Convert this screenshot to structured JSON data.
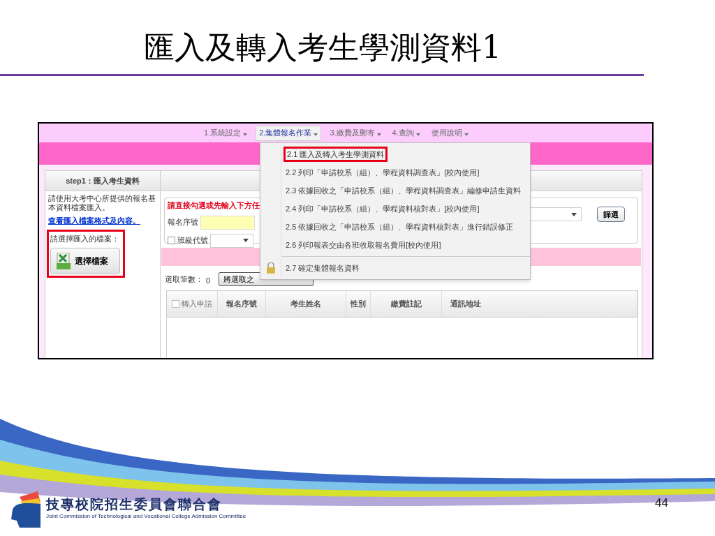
{
  "slide_title": "匯入及轉入考生學測資料1",
  "nav_menus": [
    {
      "label": "1.系統設定",
      "selected": false
    },
    {
      "label": "2.集體報名作業",
      "selected": true
    },
    {
      "label": "3.繳費及郵寄",
      "selected": false
    },
    {
      "label": "4.查詢",
      "selected": false
    },
    {
      "label": "使用說明",
      "selected": false
    }
  ],
  "dropdown_items": [
    {
      "label": "2.1 匯入及轉入考生學測資料",
      "kind": "item",
      "selected": true
    },
    {
      "label": "2.2 列印「申請校系（組）、學程資料調查表」[校內使用]",
      "kind": "item",
      "selected": false
    },
    {
      "label": "2.3 依據回收之「申請校系（組）、學程資料調查表」編修申請生資料",
      "kind": "item",
      "selected": false
    },
    {
      "label": "2.4 列印「申請校系（組）、學程資料核對表」[校內使用]",
      "kind": "item",
      "selected": false
    },
    {
      "label": "2.5 依據回收之「申請校系（組）、學程資料核對表」進行錯誤修正",
      "kind": "item",
      "selected": false
    },
    {
      "label": "2.6 列印報表交由各班收取報名費用[校內使用]",
      "kind": "item",
      "selected": false
    },
    {
      "label": "2.7 確定集體報名資料",
      "kind": "locked",
      "selected": false
    }
  ],
  "left_panel": {
    "step_title": "step1：匯入考生資料",
    "instructions": "請使用大考中心所提供的報名基本資料檔案匯入。",
    "format_link": "查看匯入檔案格式及內容。",
    "choose_label": "請選擇匯入的檔案：",
    "choose_button": "選擇檔案",
    "highlighted": true
  },
  "filter": {
    "hint": "請直接勾選或先輸入下方任",
    "serial_label": "報名序號",
    "class_checkbox": {
      "label": "班級代號",
      "checked": false
    },
    "filter_button": "篩選"
  },
  "selection": {
    "count_label": "選取筆數：",
    "count": "0",
    "transfer_button": "將選取之"
  },
  "table": {
    "select_all": {
      "label": "轉入申請",
      "checked": false
    },
    "columns": [
      "報名序號",
      "考生姓名",
      "性別",
      "繳費註記",
      "通訊地址"
    ]
  },
  "footer": {
    "org_name": "技專校院招生委員會聯合會",
    "org_english": "Joint Commission of Technological and Vocational College Admission Committee",
    "page_number": "44"
  }
}
